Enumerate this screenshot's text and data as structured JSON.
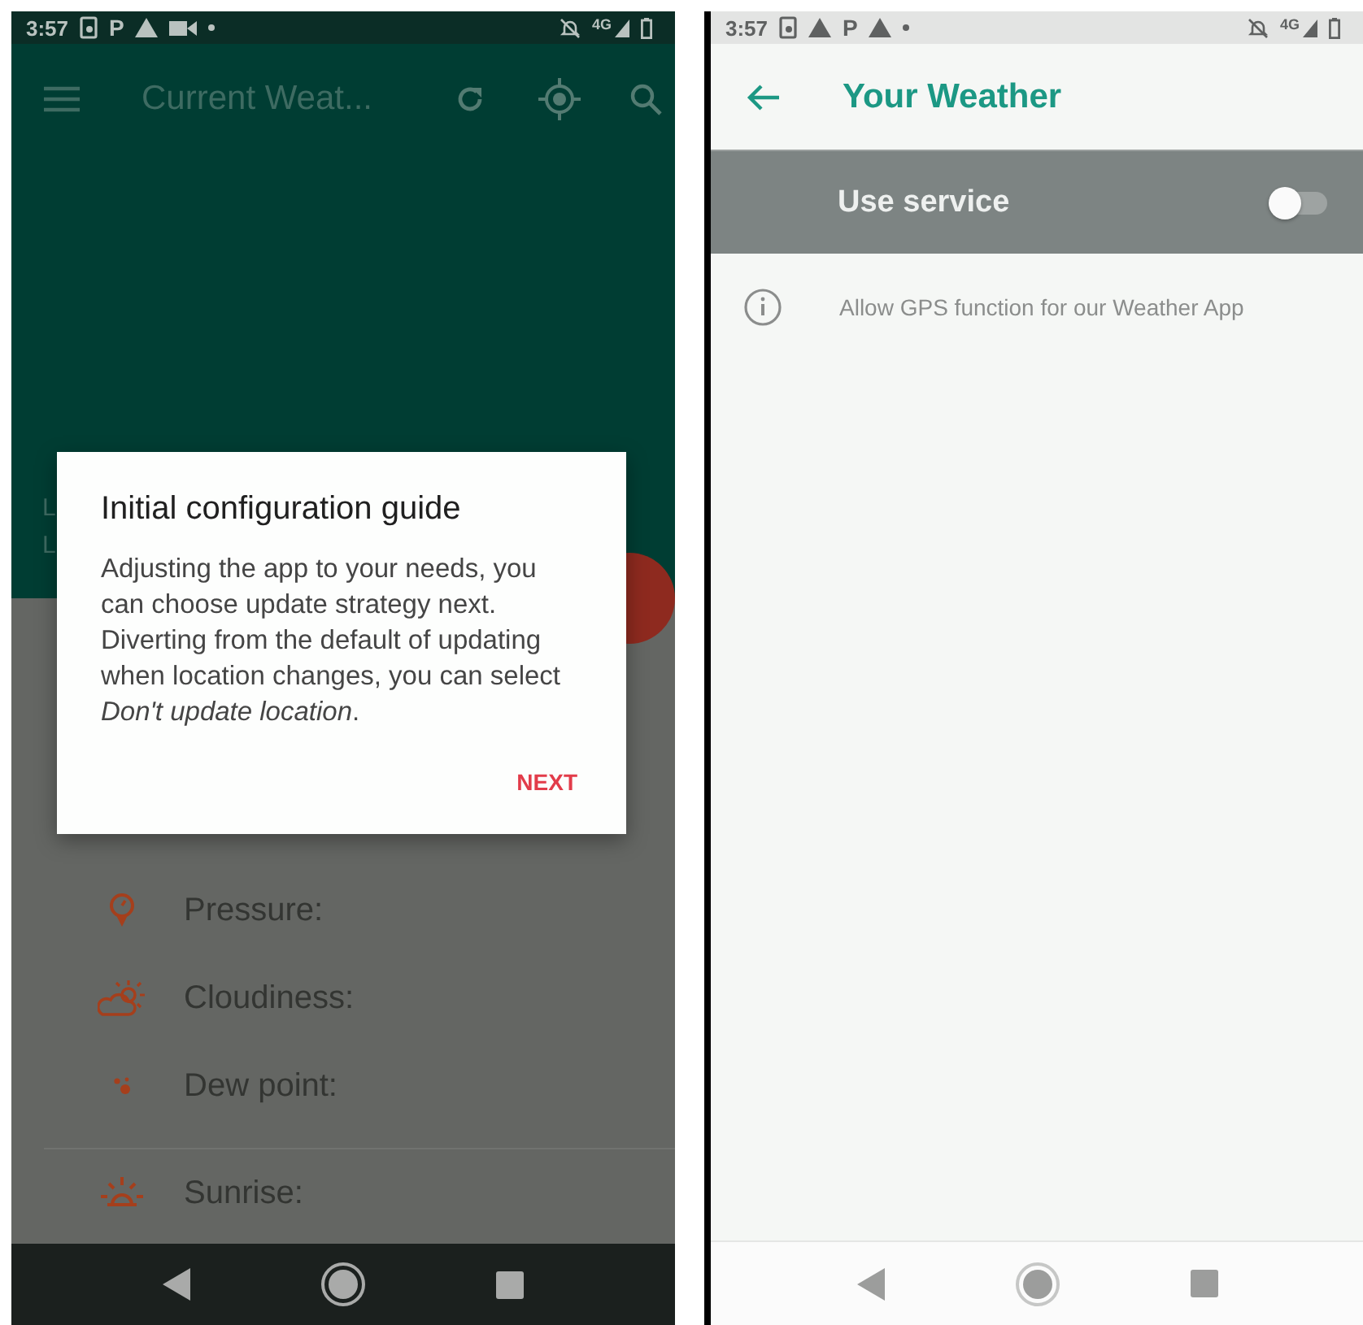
{
  "left_screen": {
    "status_bar": {
      "time": "3:57",
      "letter_icon": "P",
      "network": "4G"
    },
    "app_bar": {
      "title": "Current Weat..."
    },
    "header_lines": [
      "L",
      "L"
    ],
    "dialog": {
      "title": "Initial configuration guide",
      "message": "Adjusting the app to your needs, you can choose update strategy next. Diverting from the default of updating when location changes, you can select *Don't update location*.",
      "button": "NEXT"
    },
    "details": [
      {
        "kind": "pressure",
        "label": "Pressure:"
      },
      {
        "kind": "cloudiness",
        "label": "Cloudiness:"
      },
      {
        "kind": "dew_point",
        "label": "Dew point:"
      },
      {
        "kind": "sunrise",
        "label": "Sunrise:"
      }
    ]
  },
  "right_screen": {
    "status_bar": {
      "time": "3:57",
      "letter_icon": "P",
      "network": "4G"
    },
    "toolbar": {
      "title": "Your Weather"
    },
    "switch_row": {
      "label": "Use service",
      "on": false
    },
    "info": {
      "text": "Allow GPS function for our Weather App"
    }
  }
}
